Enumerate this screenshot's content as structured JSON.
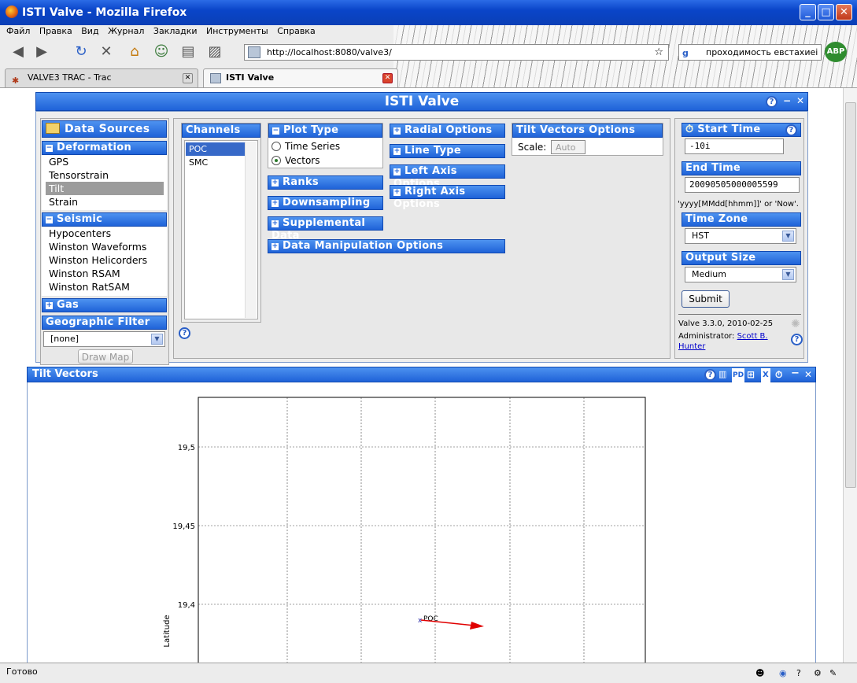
{
  "window": {
    "title": "ISTI Valve - Mozilla Firefox"
  },
  "menu": [
    "Файл",
    "Правка",
    "Вид",
    "Журнал",
    "Закладки",
    "Инструменты",
    "Справка"
  ],
  "address": {
    "url": "http://localhost:8080/valve3/"
  },
  "search": {
    "value": "проходимость евстахиеі"
  },
  "addon": {
    "label": "ABP"
  },
  "tabs": [
    {
      "label": "VALVE3 TRAC - Trac",
      "active": false
    },
    {
      "label": "ISTI Valve",
      "active": true
    }
  ],
  "status": {
    "text": "Готово"
  },
  "valve": {
    "title": "ISTI Valve"
  },
  "datasources": {
    "title": "Data Sources",
    "groups": [
      {
        "label": "Deformation",
        "items": [
          "GPS",
          "Tensorstrain",
          "Tilt",
          "Strain"
        ],
        "selected": "Tilt"
      },
      {
        "label": "Seismic",
        "items": [
          "Hypocenters",
          "Winston Waveforms",
          "Winston Helicorders",
          "Winston RSAM",
          "Winston RatSAM"
        ]
      },
      {
        "label": "Gas"
      }
    ],
    "geo": {
      "title": "Geographic Filter",
      "value": "[none]",
      "draw": "Draw Map"
    }
  },
  "channels": {
    "title": "Channels",
    "items": [
      "POC",
      "SMC"
    ],
    "selected": "POC"
  },
  "plottype": {
    "title": "Plot Type",
    "options": [
      "Time Series",
      "Vectors"
    ],
    "selected": "Vectors"
  },
  "sections": {
    "ranks": "Ranks",
    "downsampling": "Downsampling",
    "supplemental": "Supplemental Data",
    "manipulation": "Data Manipulation Options",
    "radial": "Radial Options",
    "linetype": "Line Type",
    "leftaxis": "Left Axis Options",
    "rightaxis": "Right Axis Options"
  },
  "tiltvec": {
    "title": "Tilt Vectors Options",
    "scale_label": "Scale:",
    "scale_value": "Auto"
  },
  "time": {
    "start_label": "Start Time",
    "start_value": "-10i",
    "end_label": "End Time",
    "end_value": "20090505000005599",
    "hint": "'yyyy[MMdd[hhmm]]' or 'Now'.",
    "zone_label": "Time Zone",
    "zone_value": "HST",
    "size_label": "Output Size",
    "size_value": "Medium",
    "submit": "Submit"
  },
  "footer": {
    "version": "Valve 3.3.0, 2010-02-25",
    "admin_label": "Administrator:",
    "admin_name_1": "Scott B.",
    "admin_name_2": "Hunter"
  },
  "plot": {
    "title": "Tilt Vectors",
    "pd": "PD",
    "x": "X"
  },
  "chart_data": {
    "type": "scatter",
    "title": "",
    "ylabel": "Latitude",
    "yticks": [
      "19,5",
      "19,45",
      "19,4"
    ],
    "ytick_values": [
      19.5,
      19.45,
      19.4
    ],
    "grid": true,
    "points": [
      {
        "name": "POC",
        "y": 19.39
      }
    ]
  }
}
